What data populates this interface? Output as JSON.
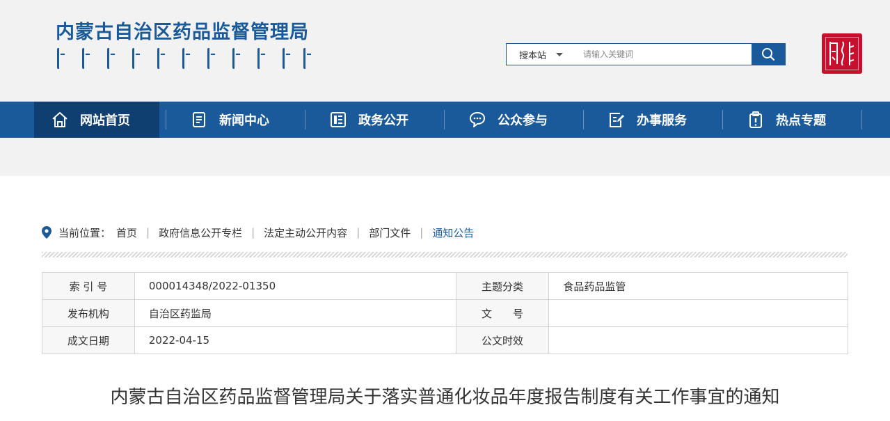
{
  "header": {
    "site_title": "内蒙古自治区药品监督管理局",
    "search": {
      "scope_label": "搜本站",
      "placeholder": "请输入关键词"
    }
  },
  "nav": {
    "items": [
      {
        "label": "网站首页",
        "icon": "home-icon"
      },
      {
        "label": "新闻中心",
        "icon": "document-icon"
      },
      {
        "label": "政务公开",
        "icon": "list-icon"
      },
      {
        "label": "公众参与",
        "icon": "chat-icon"
      },
      {
        "label": "办事服务",
        "icon": "edit-icon"
      },
      {
        "label": "热点专题",
        "icon": "clipboard-icon"
      }
    ]
  },
  "breadcrumb": {
    "prefix": "当前位置：",
    "items": [
      "首页",
      "政府信息公开专栏",
      "法定主动公开内容",
      "部门文件",
      "通知公告"
    ]
  },
  "meta": {
    "index_label": "索 引 号",
    "index_value": "000014348/2022-01350",
    "topic_label": "主题分类",
    "topic_value": "食品药品监管",
    "publisher_label": "发布机构",
    "publisher_value": "自治区药监局",
    "docno_label": "文　　号",
    "docno_value": "",
    "date_label": "成文日期",
    "date_value": "2022-04-15",
    "validity_label": "公文时效",
    "validity_value": ""
  },
  "document": {
    "title": "内蒙古自治区药品监督管理局关于落实普通化妆品年度报告制度有关工作事宜的通知"
  },
  "colors": {
    "brand_blue": "#1a5a9a",
    "nav_active": "#0f3f70",
    "seal_red": "#c8102e"
  }
}
